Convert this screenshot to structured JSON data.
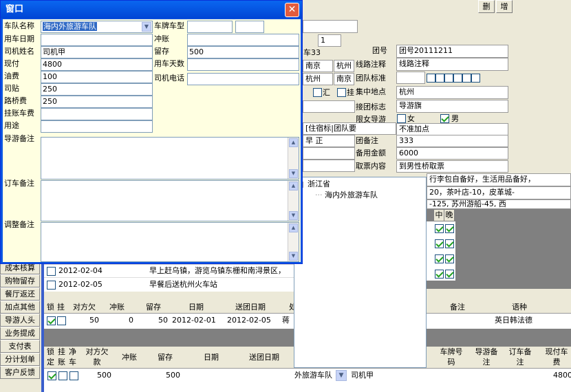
{
  "window": {
    "title": "窗口",
    "close_icon": "close-icon"
  },
  "top_buttons": {
    "delete": "删",
    "add": "增"
  },
  "bg_form": {
    "ca33": "车33",
    "nanjing1": "南京",
    "hangzhou1": "杭州",
    "hangzhou2": "杭州",
    "nanjing2": "南京",
    "hui": "汇",
    "gua": "挂",
    "num1": "1",
    "group_no_label": "团号",
    "group_no": "团号20111211",
    "route_note_label": "线路注释",
    "route_note": "线路注释",
    "group_std_label": "团队标准",
    "meet_place_label": "集中地点",
    "meet_place": "杭州",
    "group_sign_label": "接团标志",
    "group_sign": "导游旗",
    "guide_limit_label": "限女导游",
    "female": "女",
    "male": "男",
    "no_extra": "不准加点",
    "note_label_partial": "团备注",
    "note_val": "333",
    "spare_amount_label": "备用金额",
    "spare_amount": "6000",
    "ticket_label": "取票内容",
    "ticket": "到男性桥取票",
    "stay_partial": "住宿标",
    "group_req_partial": "团队要",
    "zao_zheng": "早   正",
    "long_text1": "行李包自备好，生活用品备好，",
    "long_text2": "20，茶叶店-10，皮革城-",
    "long_text3": "-125, 苏州游船-45, 西",
    "meal_mid": "中",
    "meal_eve": "晚"
  },
  "tree": {
    "root": "浙江省",
    "child": "海内外旅游车队"
  },
  "itinerary": [
    {
      "date": "2012-02-04",
      "desc": "早上赶乌镇，游览乌镇东栅和南浔景区，"
    },
    {
      "date": "2012-02-05",
      "desc": "早餐后送杭州火车站"
    }
  ],
  "sidebar": [
    "成本核算",
    "购物留存",
    "餐厅返还",
    "加点其他",
    "导游人头",
    "业务提成",
    "支付表",
    "分计划单",
    "客户反馈"
  ],
  "grid1": {
    "headers": [
      "锁",
      "挂",
      "对方欠",
      "冲账",
      "留存",
      "日期",
      "送团日期",
      "处",
      "备注",
      "语种"
    ],
    "row": {
      "locked": true,
      "owe": "50",
      "offset": "0",
      "keep": "50",
      "date": "2012-02-01",
      "send": "2012-02-05",
      "proc": "蒋",
      "lang": "英日韩法德"
    }
  },
  "grid2": {
    "headers": [
      "锁定",
      "挂账",
      "净车",
      "对方欠款",
      "冲账",
      "留存",
      "日期",
      "送团日期",
      "车牌号码",
      "导游备注",
      "订车备注",
      "现付车费"
    ],
    "row": {
      "locked": true,
      "owe": "500",
      "keep": "500",
      "fleet": "外旅游车队",
      "driver": "司机甲",
      "cash": "4800"
    }
  },
  "dialog": {
    "fleet_label": "车队名称",
    "fleet_value": "海内外旅游车队",
    "plate_label": "车牌车型",
    "date_label": "用车日期",
    "offset_label": "冲账",
    "driver_label": "司机姓名",
    "driver_value": "司机甲",
    "keep_label": "留存",
    "keep_value": "500",
    "cash_label": "现付",
    "cash_value": "4800",
    "days_label": "用车天数",
    "fuel_label": "油费",
    "fuel_value": "100",
    "phone_label": "司机电话",
    "subsidy_label": "司贴",
    "subsidy_value": "250",
    "toll_label": "路桥费",
    "toll_value": "250",
    "hang_label": "挂账车费",
    "usage_label": "用途",
    "guide_note_label": "导游备注",
    "book_note_label": "订车备注",
    "adjust_note_label": "调整备注"
  }
}
